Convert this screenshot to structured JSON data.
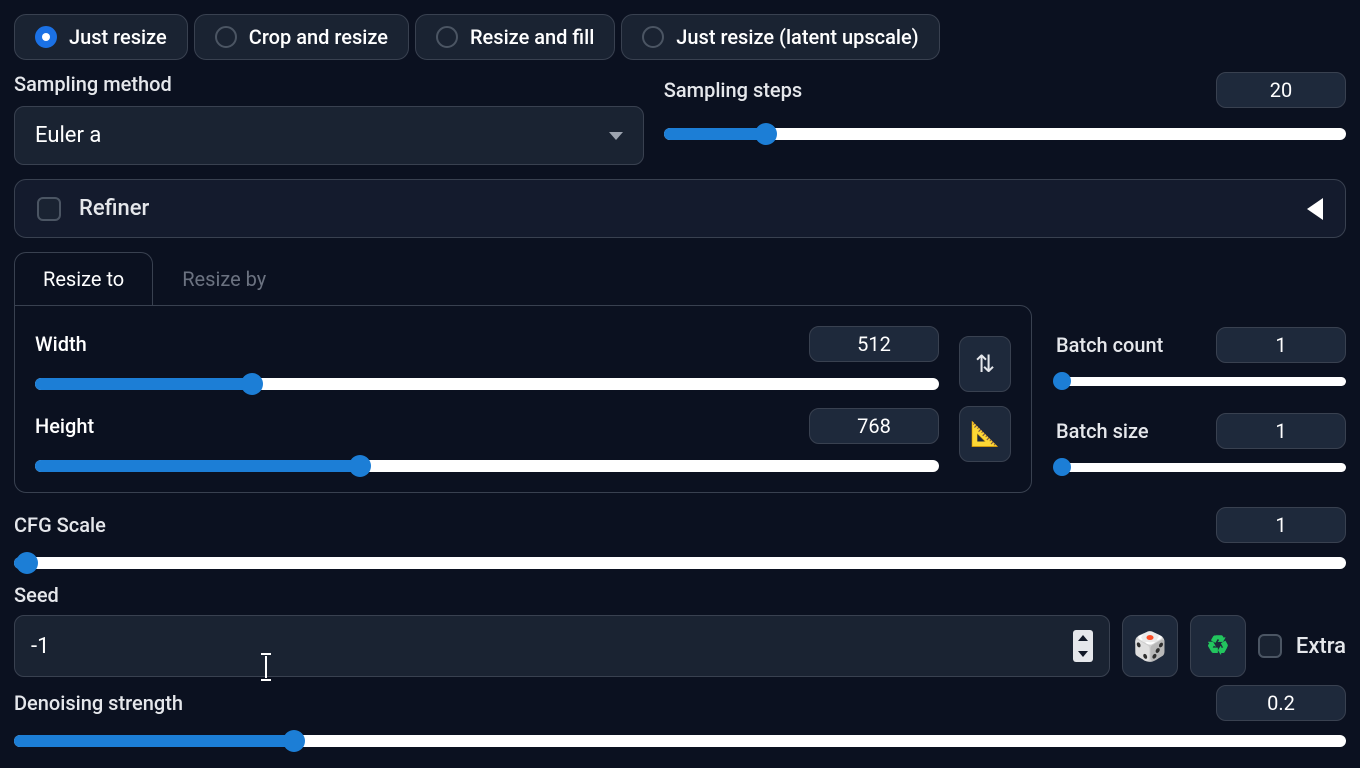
{
  "resize_mode": {
    "options": [
      {
        "label": "Just resize",
        "selected": true
      },
      {
        "label": "Crop and resize",
        "selected": false
      },
      {
        "label": "Resize and fill",
        "selected": false
      },
      {
        "label": "Just resize (latent upscale)",
        "selected": false
      }
    ]
  },
  "sampling": {
    "method_label": "Sampling method",
    "method_value": "Euler a",
    "steps_label": "Sampling steps",
    "steps_value": "20",
    "steps_fill_pct": 15
  },
  "refiner": {
    "label": "Refiner",
    "checked": false
  },
  "tabs": {
    "resize_to": "Resize to",
    "resize_by": "Resize by",
    "active": "resize_to"
  },
  "dimensions": {
    "width_label": "Width",
    "width_value": "512",
    "width_fill_pct": 24,
    "height_label": "Height",
    "height_value": "768",
    "height_fill_pct": 36
  },
  "batch": {
    "count_label": "Batch count",
    "count_value": "1",
    "count_fill_pct": 2,
    "size_label": "Batch size",
    "size_value": "1",
    "size_fill_pct": 2
  },
  "cfg": {
    "label": "CFG Scale",
    "value": "1",
    "fill_pct": 1
  },
  "seed": {
    "label": "Seed",
    "value": "-1",
    "extra_label": "Extra",
    "extra_checked": false
  },
  "denoise": {
    "label": "Denoising strength",
    "value": "0.2",
    "fill_pct": 21
  }
}
